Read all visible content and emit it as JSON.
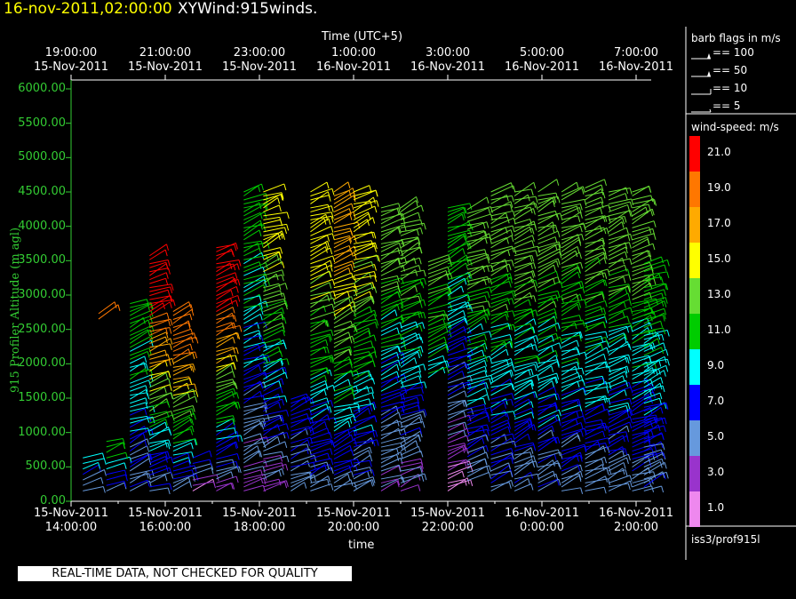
{
  "header": {
    "timestamp": "16-nov-2011,02:00:00",
    "plot_name": "XYWind:915winds."
  },
  "top_axis": {
    "label": "Time (UTC+5)",
    "ticks": [
      {
        "time": "19:00:00",
        "date": "15-Nov-2011"
      },
      {
        "time": "21:00:00",
        "date": "15-Nov-2011"
      },
      {
        "time": "23:00:00",
        "date": "15-Nov-2011"
      },
      {
        "time": "1:00:00",
        "date": "16-Nov-2011"
      },
      {
        "time": "3:00:00",
        "date": "16-Nov-2011"
      },
      {
        "time": "5:00:00",
        "date": "16-Nov-2011"
      },
      {
        "time": "7:00:00",
        "date": "16-Nov-2011"
      }
    ]
  },
  "bottom_axis": {
    "label": "time",
    "ticks": [
      {
        "date": "15-Nov-2011",
        "time": "14:00:00"
      },
      {
        "date": "15-Nov-2011",
        "time": "16:00:00"
      },
      {
        "date": "15-Nov-2011",
        "time": "18:00:00"
      },
      {
        "date": "15-Nov-2011",
        "time": "20:00:00"
      },
      {
        "date": "15-Nov-2011",
        "time": "22:00:00"
      },
      {
        "date": "16-Nov-2011",
        "time": "0:00:00"
      },
      {
        "date": "16-Nov-2011",
        "time": "2:00:00"
      }
    ]
  },
  "y_axis": {
    "label": "915 Profiler Altitude (m agl)",
    "ticks": [
      "0.00",
      "500.00",
      "1000.00",
      "1500.00",
      "2000.00",
      "2500.00",
      "3000.00",
      "3500.00",
      "4000.00",
      "4500.00",
      "5000.00",
      "5500.00",
      "6000.00"
    ]
  },
  "barb_legend": {
    "title": "barb flags in m/s",
    "items": [
      "== 100",
      "== 50",
      "== 10",
      "== 5"
    ]
  },
  "speed_legend": {
    "title": "wind-speed: m/s",
    "entries": [
      {
        "label": "21.0",
        "color": "#ff0000"
      },
      {
        "label": "19.0",
        "color": "#ff7700"
      },
      {
        "label": "17.0",
        "color": "#ffaa00"
      },
      {
        "label": "15.0",
        "color": "#ffff00"
      },
      {
        "label": "13.0",
        "color": "#66dd33"
      },
      {
        "label": "11.0",
        "color": "#00cc00"
      },
      {
        "label": "9.0",
        "color": "#00ffff"
      },
      {
        "label": "7.0",
        "color": "#0000ff"
      },
      {
        "label": "5.0",
        "color": "#6699dd"
      },
      {
        "label": "3.0",
        "color": "#9933cc"
      },
      {
        "label": "1.0",
        "color": "#ee88ee"
      }
    ]
  },
  "station": "iss3/prof915l",
  "footer": "REAL-TIME DATA, NOT CHECKED FOR QUALITY",
  "chart_data": {
    "type": "scatter",
    "title": "XYWind:915winds.",
    "xlabel": "time",
    "ylabel": "915 Profiler Altitude (m agl)",
    "xlim": [
      "15-Nov-2011 14:00:00",
      "16-Nov-2011 02:20:00"
    ],
    "ylim": [
      0,
      6000
    ],
    "x_tick_interval_hours": 2,
    "color_variable": "wind-speed: m/s",
    "profiles": [
      {
        "time": "15-Nov-2011 14:15",
        "alt_range": [
          150,
          700
        ],
        "speed_range": [
          5,
          9
        ]
      },
      {
        "time": "15-Nov-2011 14:35",
        "alt_range": [
          2650,
          2800
        ],
        "speed_range": [
          20,
          21
        ]
      },
      {
        "time": "15-Nov-2011 14:45",
        "alt_range": [
          150,
          900
        ],
        "speed_range": [
          5,
          11
        ]
      },
      {
        "time": "15-Nov-2011 15:15",
        "alt_range": [
          150,
          2900
        ],
        "speed_range": [
          5,
          11
        ]
      },
      {
        "time": "15-Nov-2011 15:40",
        "alt_range": [
          150,
          3600
        ],
        "speed_range": [
          5,
          21
        ]
      },
      {
        "time": "15-Nov-2011 16:10",
        "alt_range": [
          150,
          2800
        ],
        "speed_range": [
          5,
          19
        ]
      },
      {
        "time": "15-Nov-2011 16:35",
        "alt_range": [
          150,
          700
        ],
        "speed_range": [
          1,
          7
        ]
      },
      {
        "time": "15-Nov-2011 17:05",
        "alt_range": [
          150,
          3700
        ],
        "speed_range": [
          3,
          21
        ]
      },
      {
        "time": "15-Nov-2011 17:40",
        "alt_range": [
          150,
          4550
        ],
        "speed_range": [
          3,
          11
        ]
      },
      {
        "time": "15-Nov-2011 18:05",
        "alt_range": [
          150,
          4550
        ],
        "speed_range": [
          3,
          15
        ]
      },
      {
        "time": "15-Nov-2011 18:40",
        "alt_range": [
          150,
          1500
        ],
        "speed_range": [
          5,
          7
        ]
      },
      {
        "time": "15-Nov-2011 19:05",
        "alt_range": [
          150,
          4550
        ],
        "speed_range": [
          5,
          15
        ]
      },
      {
        "time": "15-Nov-2011 19:35",
        "alt_range": [
          150,
          4550
        ],
        "speed_range": [
          5,
          17
        ]
      },
      {
        "time": "15-Nov-2011 20:00",
        "alt_range": [
          150,
          4550
        ],
        "speed_range": [
          5,
          15
        ]
      },
      {
        "time": "15-Nov-2011 20:35",
        "alt_range": [
          150,
          4300
        ],
        "speed_range": [
          3,
          13
        ]
      },
      {
        "time": "15-Nov-2011 21:00",
        "alt_range": [
          150,
          4300
        ],
        "speed_range": [
          3,
          13
        ]
      },
      {
        "time": "15-Nov-2011 21:35",
        "alt_range": [
          1800,
          3500
        ],
        "speed_range": [
          9,
          13
        ]
      },
      {
        "time": "15-Nov-2011 22:00",
        "alt_range": [
          150,
          4300
        ],
        "speed_range": [
          1,
          11
        ]
      },
      {
        "time": "15-Nov-2011 22:25",
        "alt_range": [
          300,
          4300
        ],
        "speed_range": [
          5,
          13
        ]
      },
      {
        "time": "15-Nov-2011 22:55",
        "alt_range": [
          150,
          4500
        ],
        "speed_range": [
          5,
          13
        ]
      },
      {
        "time": "15-Nov-2011 23:25",
        "alt_range": [
          150,
          4500
        ],
        "speed_range": [
          5,
          13
        ]
      },
      {
        "time": "15-Nov-2011 23:55",
        "alt_range": [
          150,
          4550
        ],
        "speed_range": [
          5,
          13
        ]
      },
      {
        "time": "16-Nov-2011 00:25",
        "alt_range": [
          150,
          4550
        ],
        "speed_range": [
          5,
          13
        ]
      },
      {
        "time": "16-Nov-2011 00:55",
        "alt_range": [
          150,
          4600
        ],
        "speed_range": [
          5,
          13
        ]
      },
      {
        "time": "16-Nov-2011 01:25",
        "alt_range": [
          150,
          4550
        ],
        "speed_range": [
          5,
          13
        ]
      },
      {
        "time": "16-Nov-2011 01:55",
        "alt_range": [
          150,
          4550
        ],
        "speed_range": [
          5,
          13
        ]
      },
      {
        "time": "16-Nov-2011 02:10",
        "alt_range": [
          150,
          3500
        ],
        "speed_range": [
          5,
          11
        ]
      }
    ]
  }
}
